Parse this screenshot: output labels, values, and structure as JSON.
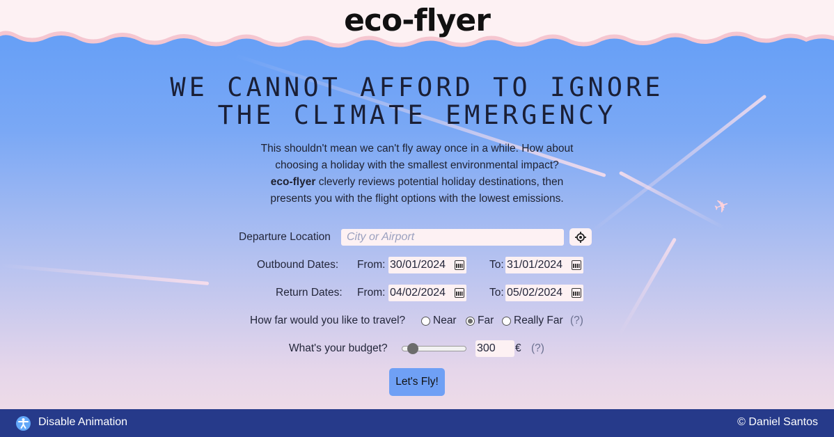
{
  "header": {
    "logo": "eco-flyer"
  },
  "hero": {
    "headline_line1": "WE CANNOT AFFORD TO IGNORE",
    "headline_line2": "THE CLIMATE EMERGENCY",
    "intro_line1": "This shouldn't mean we can't fly away once in a while. How about",
    "intro_line2": "choosing a holiday with the smallest environmental impact?",
    "intro_brand": "eco-flyer",
    "intro_line3_rest": " cleverly reviews potential holiday destinations, then",
    "intro_line4": "presents you with the flight options with the lowest emissions."
  },
  "form": {
    "departure_label": "Departure Location",
    "departure_placeholder": "City or Airport",
    "departure_value": "",
    "locate_icon": "crosshair-icon",
    "outbound_label": "Outbound Dates:",
    "return_label": "Return Dates:",
    "from_label": "From:",
    "to_label": "To:",
    "outbound_from": "30/01/2024",
    "outbound_to": "31/01/2024",
    "return_from": "04/02/2024",
    "return_to": "05/02/2024",
    "distance_question": "How far would you like to travel?",
    "distance_options": [
      "Near",
      "Far",
      "Really Far"
    ],
    "distance_selected": "Far",
    "help_text": "(?)",
    "budget_question": "What's your budget?",
    "budget_value": "300",
    "budget_fraction": 0.1,
    "currency": "€",
    "submit_label": "Let's Fly!"
  },
  "footer": {
    "accessibility_icon": "accessibility-icon",
    "disable_animation_label": "Disable Animation",
    "copyright": "© Daniel Santos"
  },
  "colors": {
    "footer_bg": "#263a8a",
    "button_bg": "#6fa0f5",
    "cloud_fill": "#fdf1f3",
    "cloud_edge": "#f5c6d0"
  }
}
